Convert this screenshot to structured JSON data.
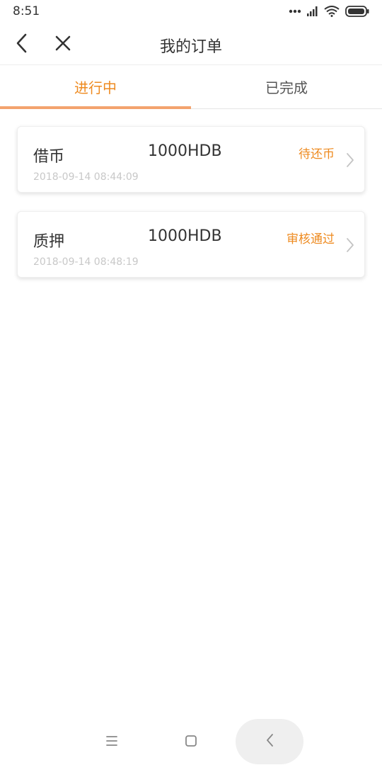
{
  "status_bar": {
    "time": "8:51",
    "icons": [
      "more-dots-icon",
      "signal-icon",
      "wifi-icon",
      "battery-icon"
    ]
  },
  "nav": {
    "title": "我的订单",
    "back_icon": "chevron-left-icon",
    "close_icon": "close-icon"
  },
  "tabs": [
    {
      "label": "进行中",
      "active": true
    },
    {
      "label": "已完成",
      "active": false
    }
  ],
  "orders": [
    {
      "type": "借币",
      "amount": "1000HDB",
      "status": "待还币",
      "time": "2018-09-14 08:44:09"
    },
    {
      "type": "质押",
      "amount": "1000HDB",
      "status": "审核通过",
      "time": "2018-09-14 08:48:19"
    }
  ],
  "system_nav": {
    "icons": [
      "menu-icon",
      "home-square-icon",
      "back-icon"
    ]
  },
  "colors": {
    "accent": "#ee8a1f",
    "tab_indicator": "#f3a36e",
    "time_text": "#c8c8c8"
  }
}
